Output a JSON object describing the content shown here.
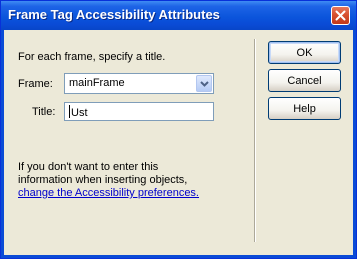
{
  "window": {
    "title": "Frame Tag Accessibility Attributes"
  },
  "form": {
    "instruction": "For each frame, specify a title.",
    "frame_label": "Frame:",
    "frame_value": "mainFrame",
    "title_label": "Title:",
    "title_value": "Ust"
  },
  "note": {
    "line1": "If you don't want to enter this",
    "line2": "information when inserting objects,",
    "link": "change the Accessibility preferences."
  },
  "buttons": {
    "ok": "OK",
    "cancel": "Cancel",
    "help": "Help"
  },
  "icons": {
    "close": "close-icon",
    "dropdown": "chevron-down-icon"
  },
  "colors": {
    "titlebar": "#0a4bd6",
    "client_bg": "#ece9d8",
    "link": "#0000cc",
    "close_button": "#d8502f"
  }
}
